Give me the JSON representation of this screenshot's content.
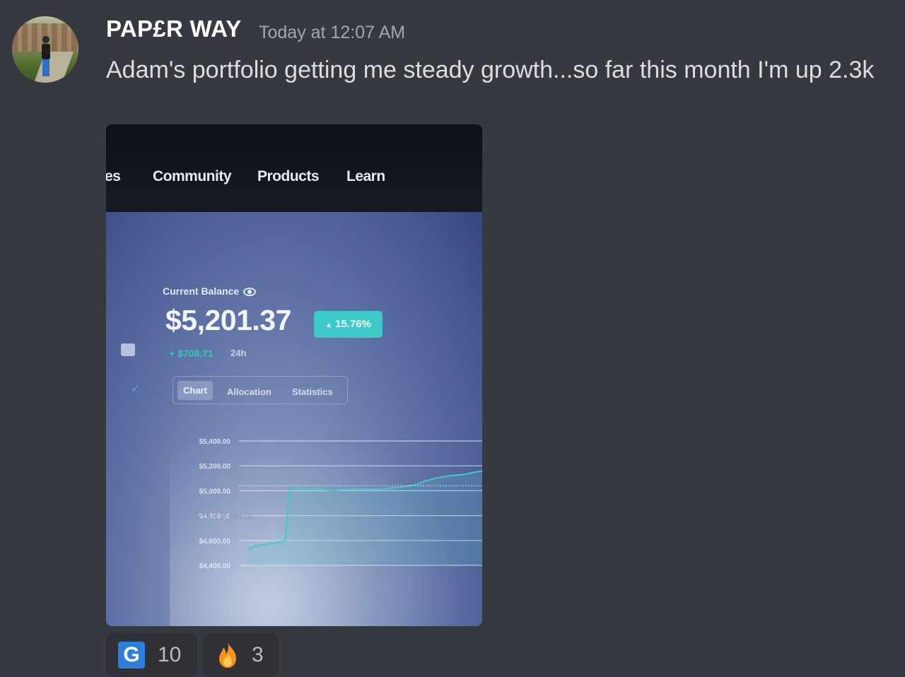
{
  "message": {
    "username": "PAP£R WAY",
    "timestamp": "Today at 12:07 AM",
    "text": "Adam's portfolio getting me steady growth...so far this month I'm up 2.3k"
  },
  "attachment": {
    "nav": {
      "items": [
        "es",
        "Community",
        "Products",
        "Learn"
      ]
    },
    "portfolio": {
      "balance_label": "Current Balance",
      "balance": "$5,201.37",
      "change_badge": "15.76%",
      "change_amount": "+ $708.71",
      "change_period": "24h",
      "tabs": [
        "Chart",
        "Allocation",
        "Statistics"
      ],
      "active_tab": "Chart",
      "footer_label": "Your Assets"
    },
    "chart_data": {
      "type": "line",
      "title": "",
      "xlabel": "",
      "ylabel": "",
      "y_ticks": [
        "$5,400.00",
        "$5,200.00",
        "$5,000.00",
        "$4,800.00",
        "$4,600.00",
        "$4,400.00"
      ],
      "ylim": [
        4400,
        5400
      ],
      "series": [
        {
          "x": [
            0,
            2,
            4,
            6,
            8,
            9,
            10,
            12,
            15,
            18,
            21,
            24,
            27,
            30,
            33,
            36,
            38,
            40,
            43,
            46,
            48,
            50
          ],
          "values": [
            4530,
            4560,
            4570,
            4580,
            4600,
            5015,
            5020,
            5010,
            5015,
            5000,
            5010,
            5015,
            5010,
            5020,
            5030,
            5050,
            5080,
            5100,
            5120,
            5130,
            5145,
            5160
          ]
        }
      ],
      "grid": true,
      "color": "#45c9c3"
    }
  },
  "reactions": [
    {
      "emoji": "G",
      "icon": "g-icon",
      "count": "10"
    },
    {
      "emoji": "fire",
      "icon": "fire-icon",
      "count": "3"
    }
  ]
}
